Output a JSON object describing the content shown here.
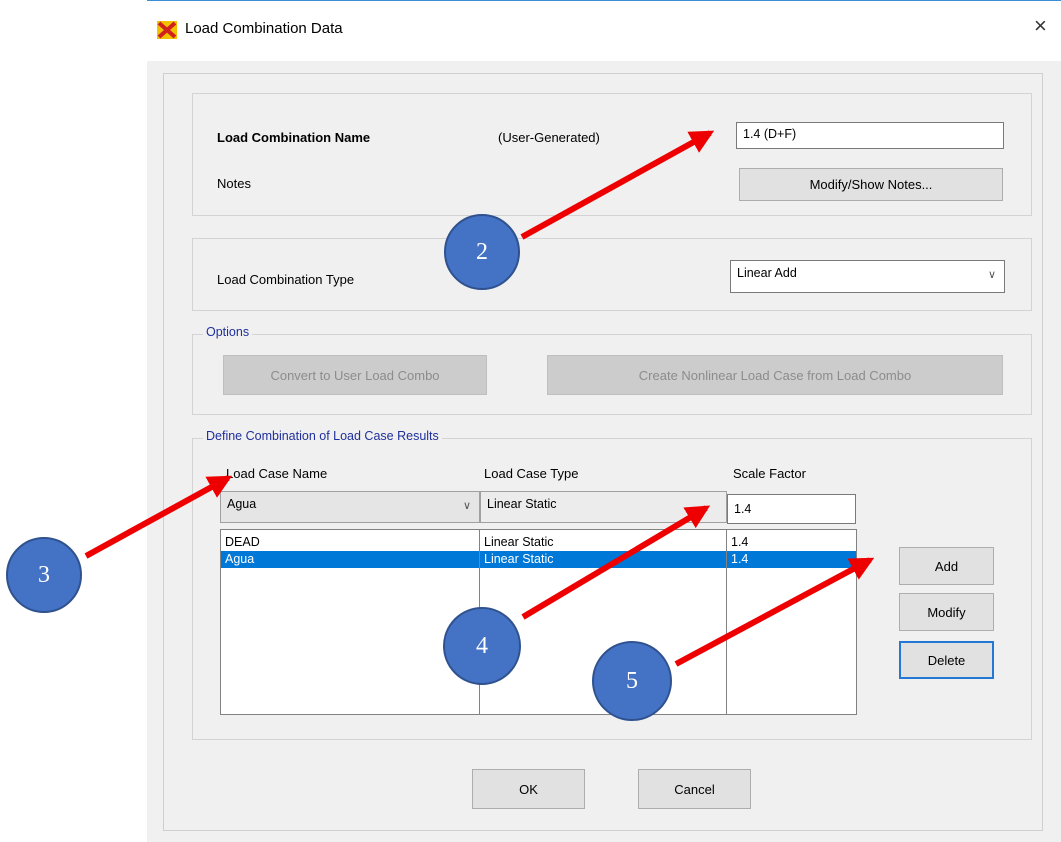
{
  "window": {
    "title": "Load Combination Data",
    "close_glyph": "×",
    "icon": "sap-app-icon"
  },
  "name_group": {
    "name_label": "Load Combination Name",
    "generated_label": "(User-Generated)",
    "name_value": "1.4 (D+F)",
    "notes_label": "Notes",
    "notes_button": "Modify/Show Notes..."
  },
  "type_group": {
    "type_label": "Load Combination Type",
    "type_value": "Linear Add",
    "chevron": "∨"
  },
  "options_group": {
    "legend": "Options",
    "convert_button": "Convert to User Load Combo",
    "create_button": "Create Nonlinear Load Case from Load Combo"
  },
  "define_group": {
    "legend": "Define Combination of Load Case Results",
    "headers": [
      "Load Case Name",
      "Load Case Type",
      "Scale Factor"
    ],
    "edit_row": {
      "case_name": "Agua",
      "case_type": "Linear Static",
      "scale_factor": "1.4"
    },
    "rows": [
      {
        "case_name": "DEAD",
        "case_type": "Linear Static",
        "scale_factor": "1.4",
        "selected": false
      },
      {
        "case_name": "Agua",
        "case_type": "Linear Static",
        "scale_factor": "1.4",
        "selected": true
      }
    ],
    "add_button": "Add",
    "modify_button": "Modify",
    "delete_button": "Delete"
  },
  "footer": {
    "ok_button": "OK",
    "cancel_button": "Cancel"
  },
  "annotations": [
    {
      "label": "2"
    },
    {
      "label": "3"
    },
    {
      "label": "4"
    },
    {
      "label": "5"
    }
  ],
  "colors": {
    "accent": "#0078d7",
    "marker_fill": "#4472c4",
    "arrow": "#ee0000",
    "legend_text": "#1f2f9c"
  }
}
